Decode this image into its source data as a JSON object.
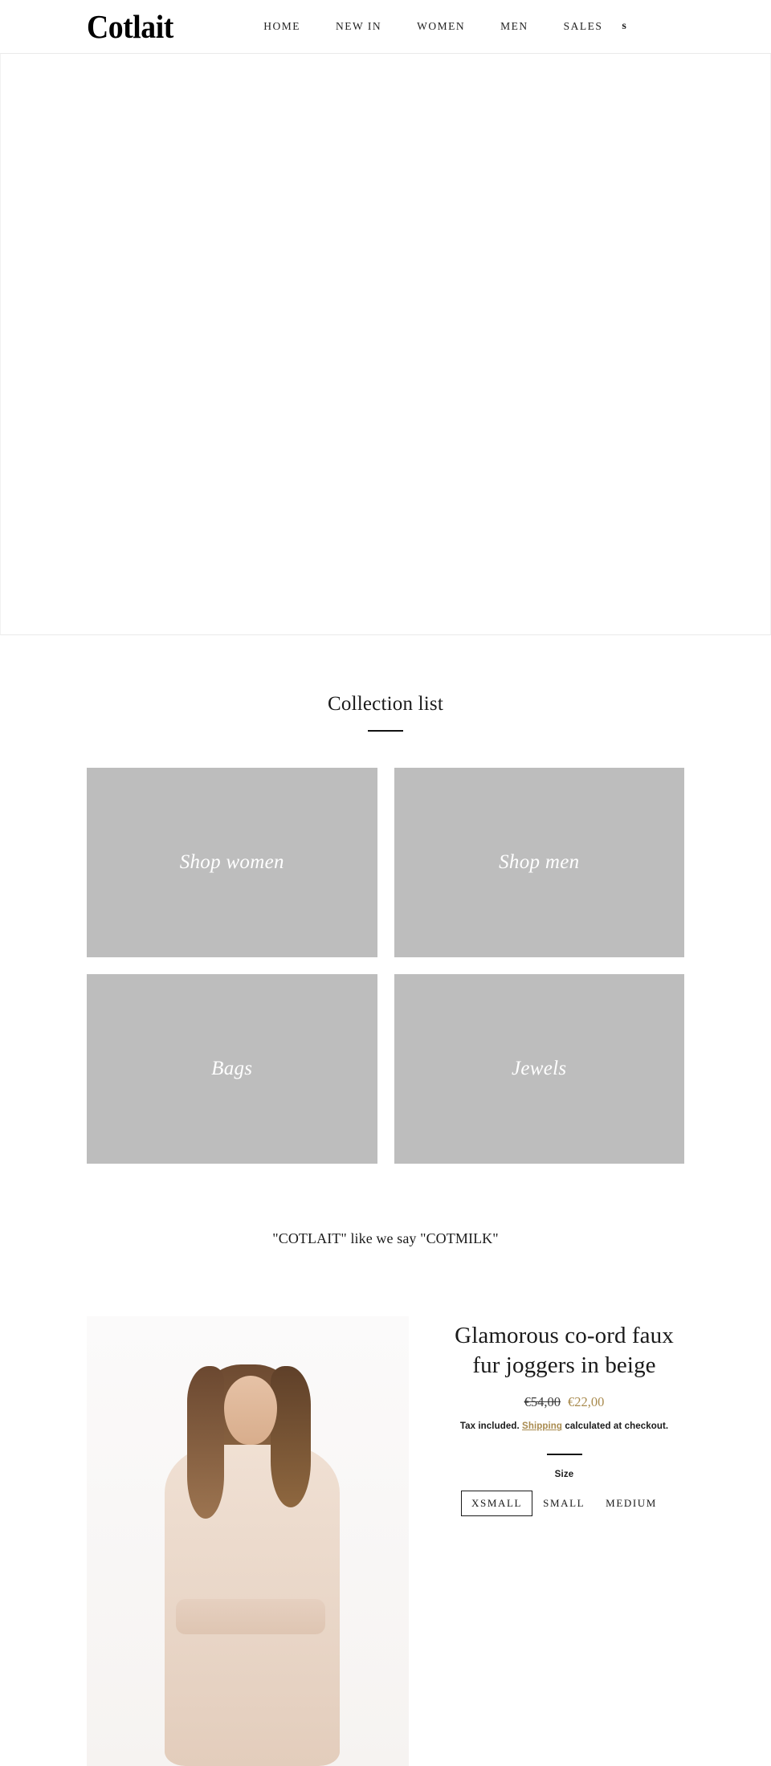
{
  "header": {
    "logo": "Cotlait",
    "nav": [
      {
        "label": "HOME"
      },
      {
        "label": "NEW IN"
      },
      {
        "label": "WOMEN"
      },
      {
        "label": "MEN"
      },
      {
        "label": "SALES"
      }
    ],
    "actions": [
      {
        "icon": "search-icon",
        "glyph": "s"
      }
    ]
  },
  "hero": {
    "placeholder": ""
  },
  "collection": {
    "title": "Collection list",
    "cards": [
      {
        "label": "Shop women",
        "image": "collection-image-women"
      },
      {
        "label": "Shop men",
        "image": "collection-image-men"
      },
      {
        "label": "Bags",
        "image": "collection-image-bags"
      },
      {
        "label": "Jewels",
        "image": "collection-image-jewels"
      }
    ]
  },
  "tagline": "\"COTLAIT\" like we say \"COTMILK\"",
  "product": {
    "title": "Glamorous co-ord faux fur joggers in beige",
    "price_compare": "€54,00",
    "price_sale": "€22,00",
    "tax_prefix": "Tax included. ",
    "shipping_link": "Shipping",
    "tax_suffix": " calculated at checkout.",
    "variant_label": "Size",
    "sizes": [
      {
        "label": "XSMALL",
        "selected": true
      },
      {
        "label": "SMALL",
        "selected": false
      },
      {
        "label": "MEDIUM",
        "selected": false
      }
    ],
    "image_alt": "model-wearing-beige-faux-fur-co-ord"
  },
  "colors": {
    "accent_gold": "#a98b4f",
    "text": "#1a1a1a",
    "placeholder_gray": "#bdbdbd"
  }
}
